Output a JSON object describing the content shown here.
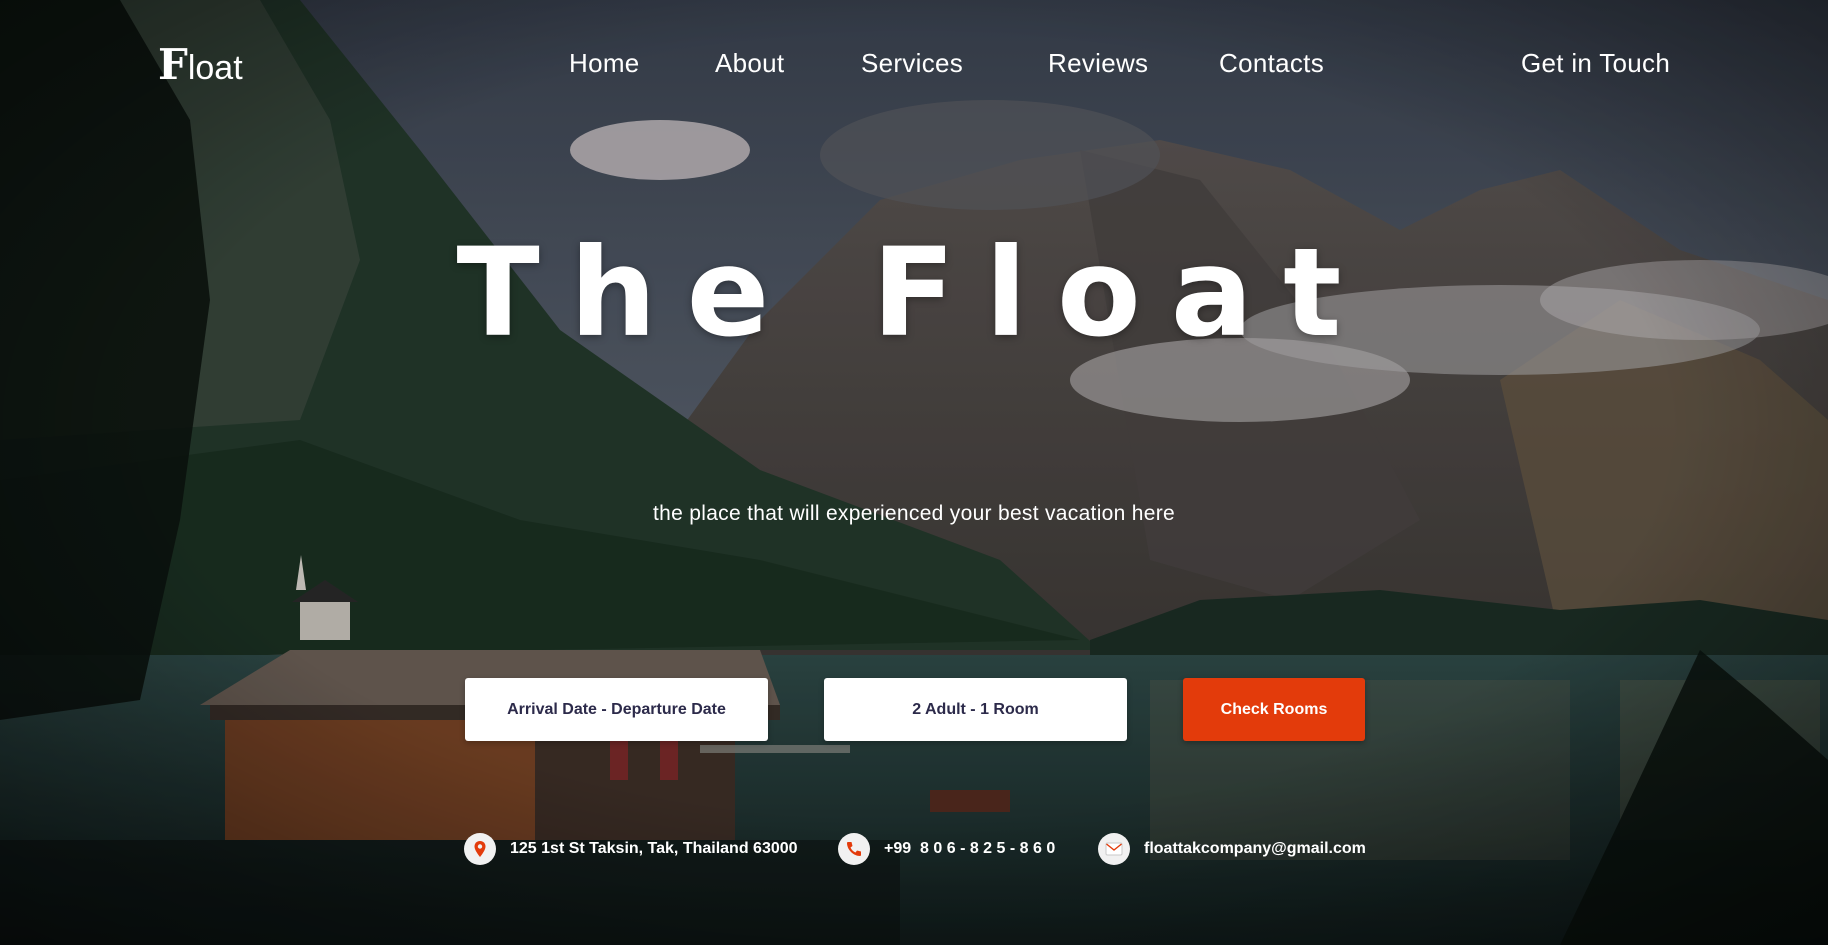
{
  "brand": {
    "logo_initial": "F",
    "logo_rest": "loat"
  },
  "nav": {
    "items": [
      {
        "label": "Home"
      },
      {
        "label": "About"
      },
      {
        "label": "Services"
      },
      {
        "label": "Reviews"
      },
      {
        "label": "Contacts"
      }
    ],
    "cta_label": "Get in Touch"
  },
  "hero": {
    "title": "The Float",
    "subtitle": "the place that will experienced your best vacation here",
    "background_image": "mountain-lake-landscape"
  },
  "booking": {
    "dates_label": "Arrival Date - Departure Date",
    "guests_label": "2 Adult - 1 Room",
    "submit_label": "Check Rooms"
  },
  "contact": {
    "address": "125 1st St Taksin, Tak, Thailand 63000",
    "phone": "+99  8 0 6 - 8 2 5 - 8 6 0",
    "email": "floattakcompany@gmail.com",
    "icons": [
      "location-pin-icon",
      "phone-icon",
      "mail-icon"
    ]
  },
  "colors": {
    "accent": "#e33b0b",
    "field_text": "#2c2a4a",
    "text_light": "#ffffff"
  }
}
